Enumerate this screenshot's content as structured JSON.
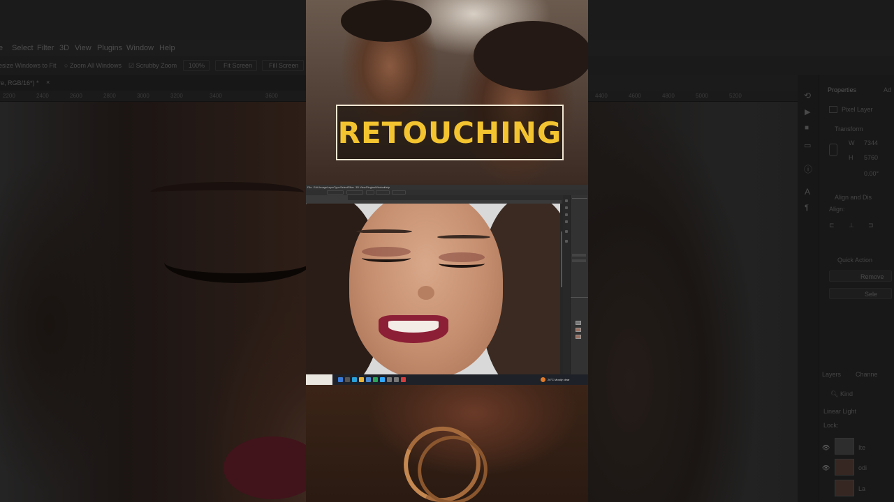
{
  "overlay_title": "RETOUCHING",
  "menu": [
    "e",
    "Select",
    "Filter",
    "3D",
    "View",
    "Plugins",
    "Window",
    "Help"
  ],
  "options_bar": {
    "resize_windows": "esize Windows to Fit",
    "zoom_all_windows": "Zoom All Windows",
    "scrubby_zoom": "Scrubby Zoom",
    "zoom_level": "100%",
    "fit_screen": "Fit Screen",
    "fill_screen": "Fill Screen"
  },
  "document_tab": "re, RGB/16*) *",
  "ruler_ticks": [
    "2200",
    "2400",
    "2600",
    "2800",
    "3000",
    "3200",
    "3400",
    "3600"
  ],
  "ruler_ticks_right": [
    "4400",
    "4600",
    "4800",
    "5000",
    "5200"
  ],
  "properties_panel": {
    "tab": "Properties",
    "tab2": "Ad",
    "pixel_layer": "Pixel Layer",
    "transform": "Transform",
    "w_label": "W",
    "w_value": "7344",
    "h_label": "H",
    "h_value": "5760",
    "angle_value": "0.00°",
    "align": "Align and Dis",
    "align_label": "Align:",
    "quick_actions": "Quick Action",
    "remove": "Remove",
    "select": "Sele"
  },
  "layers_panel": {
    "tab": "Layers",
    "tab2": "Channe",
    "kind": "Kind",
    "blend_mode": "Linear Light",
    "lock_label": "Lock:",
    "layer_names": [
      "Ite",
      "odi",
      "La"
    ]
  },
  "mini_menu": [
    "File",
    "Edit",
    "Image",
    "Layer",
    "Type",
    "Select",
    "Filter",
    "3D",
    "View",
    "Plugins",
    "Window",
    "Help"
  ],
  "mini_taskbar_text": "26°C Mostly clear",
  "colors": {
    "accent_yellow": "#f4c430",
    "ps_dark": "#2b2b2b",
    "lip": "#8c1f35"
  }
}
